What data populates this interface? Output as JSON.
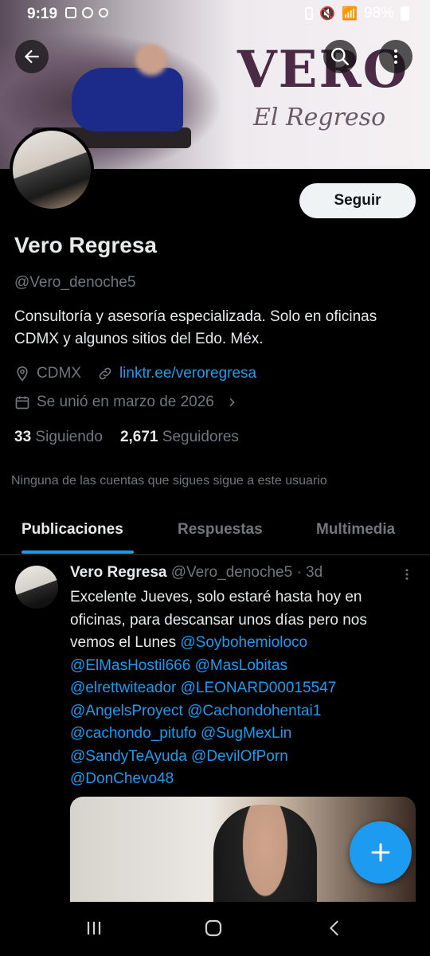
{
  "status_bar": {
    "time": "9:19",
    "battery": "98%"
  },
  "banner": {
    "title": "VERO",
    "subtitle": "El Regreso"
  },
  "profile": {
    "follow_label": "Seguir",
    "name": "Vero Regresa",
    "handle": "@Vero_denoche5",
    "bio": "Consultoría y asesoría especializada. Solo en oficinas CDMX y algunos sitios del Edo. Méx.",
    "location": "CDMX",
    "link": "linktr.ee/veroregresa",
    "joined": "Se unió en marzo de 2026",
    "following_count": "33",
    "following_label": "Siguiendo",
    "followers_count": "2,671",
    "followers_label": "Seguidores",
    "mutuals_note": "Ninguna de las cuentas que sigues sigue a este usuario"
  },
  "tabs": [
    {
      "label": "Publicaciones",
      "active": true
    },
    {
      "label": "Respuestas",
      "active": false
    },
    {
      "label": "Multimedia",
      "active": false
    }
  ],
  "post": {
    "author": "Vero Regresa",
    "handle": "@Vero_denoche5",
    "time": "· 3d",
    "text_intro": "Excelente Jueves, solo estaré hasta hoy en oficinas, para descansar unos días pero nos vemos el Lunes",
    "mentions": [
      "@Soybohemioloco",
      "@ElMasHostil666",
      "@MasLobitas",
      "@elrettwiteador",
      "@LEONARD00015547",
      "@AngelsProyect",
      "@Cachondohentai1",
      "@cachondo_pitufo",
      "@SugMexLin",
      "@SandyTeAyuda",
      "@DevilOfPorn",
      "@DonChevo48"
    ]
  },
  "colors": {
    "accent": "#1d9bf0",
    "background": "#000000",
    "text_primary": "#e7e9ea",
    "text_secondary": "#71767b"
  }
}
